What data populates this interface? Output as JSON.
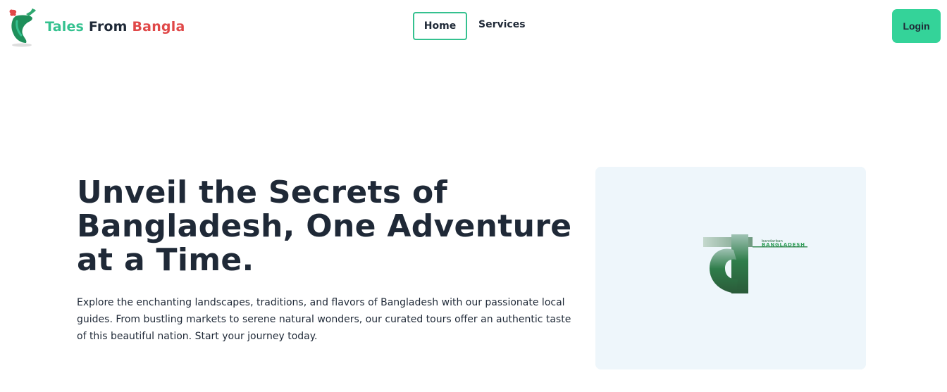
{
  "brand": {
    "word1": "Tales",
    "word2": "From",
    "word3": "Bangla",
    "logo": "bangladesh-map-plane-logo",
    "colors": {
      "word1": "#34c18f",
      "word2": "#1f2937",
      "word3": "#e04848"
    }
  },
  "nav": {
    "items": [
      {
        "label": "Home",
        "active": true
      },
      {
        "label": "Services",
        "active": false
      }
    ]
  },
  "header": {
    "login_label": "Login",
    "login_color": "#34d399"
  },
  "hero": {
    "title": "Unveil the Secrets of Bangladesh, One Adventure at a Time.",
    "description": "Explore the enchanting landscapes, traditions, and flavors of Bangladesh with our passionate local guides. From bustling markets to serene natural wonders, our curated tours offer an authentic taste of this beautiful nation. Start your journey today.",
    "image": {
      "caption_small": "bandarban",
      "caption_large": "BANGLADESH"
    }
  }
}
